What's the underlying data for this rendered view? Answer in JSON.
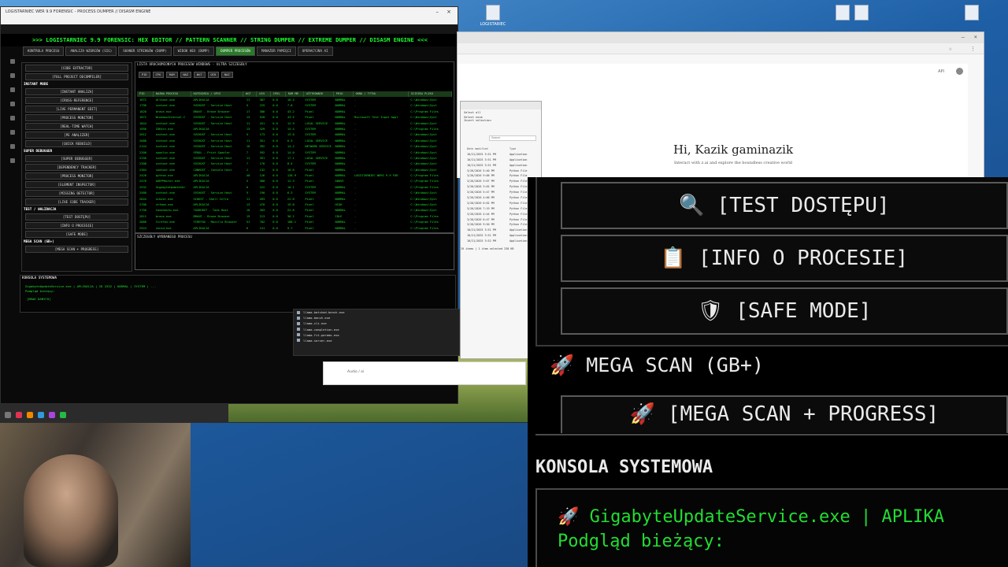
{
  "desktop": {
    "icons": [
      "LOGISTARIEC",
      "",
      "",
      "",
      ""
    ]
  },
  "app": {
    "window_title": "LOGISTARNIEC WER 9.9 FORENSIC - PROCESS DUMPER // DISASM ENGINE",
    "banner": ">>> LOGISTARNIEC 9.9 FORENSIC: HEX EDITOR // PATTERN SCANNER // STRING DUMPER // EXTREME DUMPER // DISASM ENGINE <<<",
    "tabs": [
      "KONTROLA PROCESU",
      "ANALIZA WZORCÓW (SIG)",
      "SKANER STRINGÓW (DUMP)",
      "WIDOK HEX (DUMP)",
      "DUMPER PROCESÓW",
      "MANAŻER PAMIĘCI",
      "OPERACYJNA AI"
    ],
    "left_panel": {
      "buttons_top": [
        "[CODE EXTRACTOR]",
        "[FULL PROJECT DECOMPILER]"
      ],
      "section_instant": "INSTANT MODE",
      "instant_buttons": [
        "[INSTANT ANALIZA]",
        "[CROSS-REFERENCE]",
        "[LIVE PERMANENT EDIT]",
        "[PROCESS MONITOR]",
        "[REAL-TIME WATCH]",
        "[PE ANALIZER]",
        "[QUICK REBUILD]"
      ],
      "section_super": "SUPER DEBUGGER",
      "super_buttons": [
        "[SUPER DEBUGGER]",
        "[DEPENDENCY TRACKER]",
        "[PROCESS MONITOR]",
        "[ELEMENT INSPECTOR]",
        "[MISSING DETECTOR]",
        "[LIVE CODE TRACKER]"
      ],
      "section_test": "TEST / WALIDACJA",
      "test_buttons": [
        "[TEST DOSTĘPU]",
        "[INFO O PROCESIE]",
        "[SAFE MODE]"
      ],
      "mega_label": "MEGA SCAN (GB+)",
      "mega_button": "[MEGA SCAN + PROGRESS]"
    },
    "process_panel": {
      "title": "LISTA URUCHOMIONYCH PROCESÓW WINDOWS - ULTRA SZCZEGÓŁY",
      "toolbar": [
        "PID",
        "CPU",
        "RAM",
        "NAZ",
        "WĄT",
        "UCH",
        "NAZ"
      ],
      "columns": [
        "PID",
        "NAZWA PROCESU",
        "KATEGORIA / OPIS",
        "WĄT",
        "UCH",
        "CPU%",
        "RAM MB",
        "UŻYTKOWNIK",
        "PRIO",
        "OKNO / TYTUŁ",
        "ŚCIEŻKA PLIKU"
      ],
      "rows": [
        [
          "1672",
          "dllhost.exe",
          "APLIKACJA",
          "11",
          "387",
          "0.0",
          "16.4",
          "SYSTEM",
          "NORMAL",
          "-",
          "C:\\Windows\\Syst"
        ],
        [
          "1796",
          "svchost.exe",
          "SVCHOST - Service Host",
          "5",
          "225",
          "0.0",
          "7.8",
          "SYSTEM",
          "NORMAL",
          "-",
          "C:\\Windows\\Syst"
        ],
        [
          "1820",
          "brave.exe",
          "BRAVE - Brave Browser",
          "17",
          "386",
          "0.0",
          "43.2",
          "Pixel",
          "NORMAL",
          "-",
          "C:\\Program Files"
        ],
        [
          "1872",
          "WindowsInternal.C",
          "SVCHOST - Service Host",
          "13",
          "520",
          "0.0",
          "43.5",
          "Pixel",
          "NORMAL",
          "Microsoft Text Input Appl",
          "C:\\Windows\\Syst"
        ],
        [
          "1844",
          "svchost.exe",
          "SVCHOST - Service Host",
          "11",
          "431",
          "0.0",
          "12.9",
          "LOCAL SERVICE",
          "NORMAL",
          "-",
          "C:\\Windows\\Syst"
        ],
        [
          "1956",
          "IDEdrv.exe",
          "APLIKACJA",
          "13",
          "329",
          "0.0",
          "15.4",
          "SYSTEM",
          "NORMAL",
          "-",
          "C:\\Program Files"
        ],
        [
          "2012",
          "svchost.exe",
          "SVCHOST - Service Host",
          "5",
          "173",
          "0.0",
          "13.0",
          "SYSTEM",
          "NORMAL",
          "-",
          "C:\\Windows\\Syst"
        ],
        [
          "2088",
          "svchost.exe",
          "SVCHOST - Service Host",
          "11",
          "351",
          "0.0",
          "6.3",
          "LOCAL SERVICE",
          "NORMAL",
          "-",
          "C:\\Windows\\Syst"
        ],
        [
          "2144",
          "svchost.exe",
          "SVCHOST - Service Host",
          "10",
          "392",
          "0.0",
          "14.2",
          "NETWORK SERVICE",
          "NORMAL",
          "-",
          "C:\\Windows\\Syst"
        ],
        [
          "2200",
          "spoolsv.exe",
          "SPOOL - Print Spooler",
          "7",
          "592",
          "0.0",
          "14.0",
          "SYSTEM",
          "NORMAL",
          "-",
          "C:\\Windows\\Syst"
        ],
        [
          "2256",
          "svchost.exe",
          "SVCHOST - Service Host",
          "11",
          "391",
          "0.0",
          "17.1",
          "LOCAL SERVICE",
          "NORMAL",
          "-",
          "C:\\Windows\\Syst"
        ],
        [
          "2308",
          "svchost.exe",
          "SVCHOST - Service Host",
          "7",
          "176",
          "0.0",
          "8.4",
          "SYSTEM",
          "NORMAL",
          "-",
          "C:\\Windows\\Syst"
        ],
        [
          "2364",
          "conhost.exe",
          "CONHOST - Console Host",
          "2",
          "132",
          "0.0",
          "10.6",
          "Pixel",
          "NORMAL",
          "-",
          "C:\\Windows\\Syst"
        ],
        [
          "2420",
          "python.exe",
          "APLIKACJA",
          "40",
          "126",
          "0.0",
          "128.9",
          "Pixel",
          "NORMAL",
          "LOGISTARNIEC WERS 9.9 FOR",
          "C:\\Program Files"
        ],
        [
          "2476",
          "AUEPMaster.exe",
          "APLIKACJA",
          "5",
          "380",
          "0.0",
          "12.3",
          "Pixel",
          "ABOVE",
          "-",
          "C:\\Program Files"
        ],
        [
          "2532",
          "GigabyteUpdateSer",
          "APLIKACJA",
          "6",
          "222",
          "0.0",
          "18.1",
          "SYSTEM",
          "NORMAL",
          "-",
          "C:\\Program Files"
        ],
        [
          "2588",
          "svchost.exe",
          "SVCHOST - Service Host",
          "5",
          "190",
          "0.0",
          "6.3",
          "SYSTEM",
          "NORMAL",
          "-",
          "C:\\Windows\\Syst"
        ],
        [
          "2644",
          "sihost.exe",
          "SIHOST - Shell Infra",
          "11",
          "493",
          "0.0",
          "22.0",
          "Pixel",
          "NORMAL",
          "-",
          "C:\\Windows\\Syst"
        ],
        [
          "2700",
          "ctfmon.exe",
          "APLIKACJA",
          "13",
          "470",
          "0.0",
          "19.8",
          "Pixel",
          "HIGH",
          "-",
          "C:\\Windows\\Syst"
        ],
        [
          "2756",
          "taskhostw.exe",
          "TASKHOST - Task Host",
          "10",
          "283",
          "0.0",
          "22.8",
          "Pixel",
          "NORMAL",
          "-",
          "C:\\Windows\\Syst"
        ],
        [
          "2812",
          "brave.exe",
          "BRAVE - Brave Browser",
          "19",
          "213",
          "0.0",
          "36.2",
          "Pixel",
          "IDLE",
          "-",
          "C:\\Program Files"
        ],
        [
          "2868",
          "firefox.exe",
          "FIREFOX - Mozilla Browser",
          "51",
          "782",
          "0.0",
          "188.1",
          "Pixel",
          "NORMAL",
          "-",
          "C:\\Program Files"
        ],
        [
          "2924",
          "vncsd.exe",
          "APLIKACJA",
          "6",
          "141",
          "0.0",
          "9.7",
          "Pixel",
          "NORMAL",
          "-",
          "C:\\Program Files"
        ],
        [
          "2980",
          "explorer.exe",
          "EXPLORER - Shell",
          "72",
          "2473",
          "0.0",
          "165.3",
          "Pixel",
          "NORMAL",
          "AUD | WEI | AES_MODULE",
          "C:\\Windows\\expl"
        ],
        [
          "3036",
          "brave.exe",
          "BRAVE - Brave Browser",
          "19",
          "283",
          "0.0",
          "34.5",
          "Pixel",
          "IDLE",
          "-",
          "C:\\Program Files"
        ]
      ],
      "detail_title": "SZCZEGÓŁY WYBRANEGO PROCESU"
    },
    "console": {
      "title": "KONSOLA SYSTEMOWA",
      "line1": "GigabyteUpdateService.exe | APLIKACJA | ID 2532 | NORMAL | SYSTEM | ...",
      "line2": "Podgląd bieżący:",
      "line3": "[BRAK DANYCH]"
    }
  },
  "browser": {
    "greeting": "Hi, Kazik gaminazik",
    "subtitle": "Interact with z.ai and explore the boundless creative world",
    "api_label": "API"
  },
  "explorer": {
    "sidebar": [
      "Select all",
      "Select none",
      "Invert selection"
    ],
    "search_placeholder": "Search",
    "columns": [
      "Date modified",
      "Type"
    ],
    "rows": [
      [
        "10/21/2025 3:51 PM",
        "Application"
      ],
      [
        "10/21/2025 3:51 PM",
        "Application"
      ],
      [
        "10/21/2025 3:51 PM",
        "Application"
      ],
      [
        "3/26/2026 5:40 PM",
        "Python File"
      ],
      [
        "3/26/2026 9:06 PM",
        "Python File"
      ],
      [
        "3/26/2026 3:07 PM",
        "Python File"
      ],
      [
        "3/26/2026 3:02 PM",
        "Python File"
      ],
      [
        "3/26/2026 5:47 PM",
        "Python File"
      ],
      [
        "3/26/2026 4:00 PM",
        "Python File"
      ],
      [
        "3/26/2026 6:02 PM",
        "Python File"
      ],
      [
        "3/26/2026 7:19 PM",
        "Python File"
      ],
      [
        "3/26/2026 4:44 PM",
        "Python File"
      ],
      [
        "3/26/2026 6:47 PM",
        "Python File"
      ],
      [
        "3/26/2026 9:50 PM",
        "Python File"
      ],
      [
        "10/21/2025 3:51 PM",
        "Application"
      ],
      [
        "10/21/2025 3:51 PM",
        "Application"
      ],
      [
        "10/21/2025 3:52 PM",
        "Application"
      ]
    ],
    "status": "19 items | 1 item selected 238 KB"
  },
  "file_list": [
    "llama-batched-bench.exe",
    "llama-bench.exe",
    "llama-cli.exe",
    "llama-completion.exe",
    "llama-fit-params.exe",
    "llama-server.exe"
  ],
  "audio_widget": "Audio / ai",
  "zoomed": {
    "btn_test": "[TEST DOSTĘPU]",
    "btn_info": "[INFO O PROCESIE]",
    "btn_safe": "[SAFE MODE]",
    "mega_label": "MEGA SCAN (GB+)",
    "mega_btn": "[MEGA SCAN + PROGRESS]",
    "console_title": "KONSOLA SYSTEMOWA",
    "console_line1": "GigabyteUpdateService.exe | APLIKA",
    "console_line2": "Podgląd bieżący:"
  },
  "colors": {
    "terminal_green": "#19ff2d",
    "app_bg": "#0a0a0a",
    "active_tab": "#2a7a2a"
  },
  "icons": [
    "search-icon",
    "clipboard-icon",
    "shield-icon",
    "rocket-icon",
    "window-icon"
  ]
}
